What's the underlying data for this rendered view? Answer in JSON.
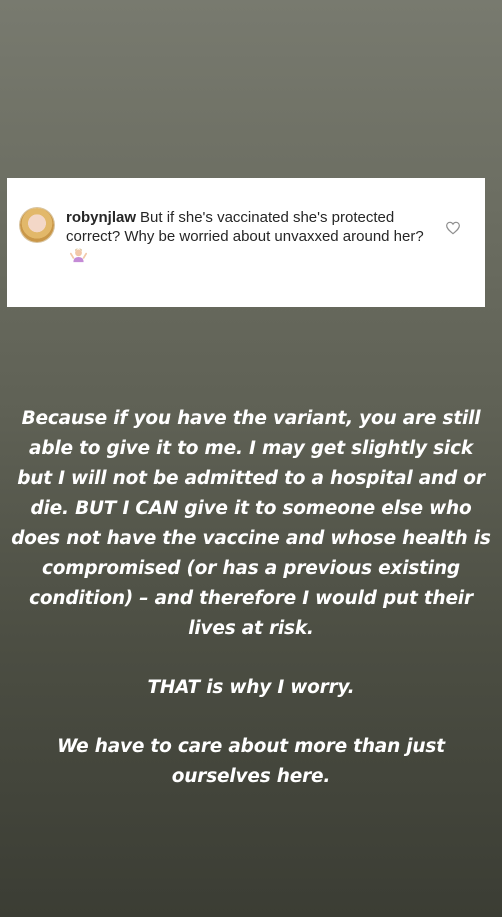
{
  "comment": {
    "username": "robynjlaw",
    "text": "But if she's vaccinated she's protected correct? Why be worried about unvaxxed around her?",
    "emoji": "person-shrugging-emoji",
    "avatar": "profile-photo",
    "like_icon": "heart-outline-icon"
  },
  "story_text": {
    "paragraph_1": "Because if you have the variant, you are still able to give it to me. I may get slightly sick but I will not be admitted to a hospital and or die. BUT I CAN give it to someone else who does not have the vaccine and whose health is compromised (or has a previous existing condition) – and therefore I would put their lives at risk.",
    "paragraph_2": "THAT is why I worry.",
    "paragraph_3": "We have to care about more than just ourselves here."
  },
  "colors": {
    "background_top": "#787a6f",
    "background_bottom": "#3b3d34",
    "card": "#ffffff",
    "text": "#ffffff"
  }
}
